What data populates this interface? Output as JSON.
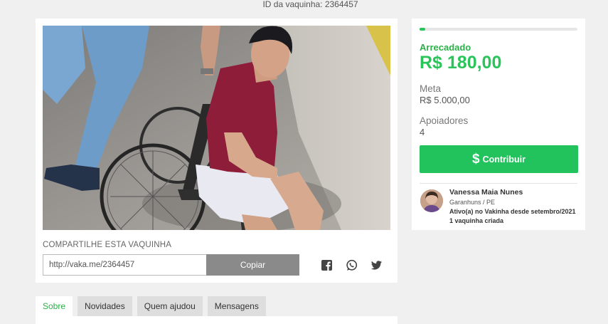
{
  "header": {
    "vaquinha_id": "ID da vaquinha: 2364457"
  },
  "photo": {
    "alt": "Homem de camiseta vermelha sentado em cadeira de rodas sendo empurrado"
  },
  "share": {
    "title": "COMPARTILHE ESTA VAQUINHA",
    "link": "http://vaka.me/2364457",
    "copy_label": "Copiar",
    "icons": [
      "facebook-icon",
      "whatsapp-icon",
      "twitter-icon"
    ]
  },
  "tabs": [
    "Sobre",
    "Novidades",
    "Quem ajudou",
    "Mensagens"
  ],
  "active_tab": "Sobre",
  "stats": {
    "progress_percent": 3.6,
    "raised_label": "Arrecadado",
    "raised_value": "R$ 180,00",
    "goal_label": "Meta",
    "goal_value": "R$ 5.000,00",
    "supporters_label": "Apoiadores",
    "supporters_value": "4"
  },
  "contribute": {
    "icon": "$",
    "label": "Contribuir"
  },
  "owner": {
    "name": "Vanessa Maia Nunes",
    "location": "Garanhuns / PE",
    "active_since": "Ativo(a) no Vakinha desde setembro/2021",
    "created": "1 vaquinha criada"
  },
  "colors": {
    "accent_green": "#2bc45a",
    "button_green": "#22c25c",
    "page_bg": "#f0f0f0",
    "copy_button": "#8a8a8a"
  }
}
